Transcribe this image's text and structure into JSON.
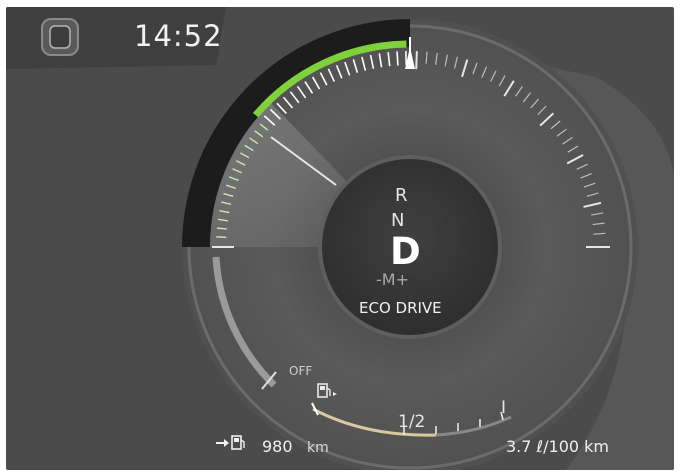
{
  "header": {
    "time": "14:52",
    "home_icon": "home-square-icon"
  },
  "gear_selector": {
    "reverse": "R",
    "neutral": "N",
    "drive": "D",
    "manual": "-M+"
  },
  "drive_mode": "ECO DRIVE",
  "power_gauge": {
    "off_label": "OFF",
    "eco_zone_level": 0.55
  },
  "fuel_gauge": {
    "half_label": "1/2",
    "full_label": "I",
    "fuel_icon": "fuel-pump-icon",
    "level": 0.5
  },
  "trip": {
    "range_icon": "range-fuel-icon",
    "range_value": "980",
    "range_unit": "km",
    "consumption": "3.7 ℓ/100 km"
  },
  "colors": {
    "eco_green": "#7fd23a",
    "fuel_fill": "#d9c8a0",
    "background": "#4b4b4b"
  }
}
